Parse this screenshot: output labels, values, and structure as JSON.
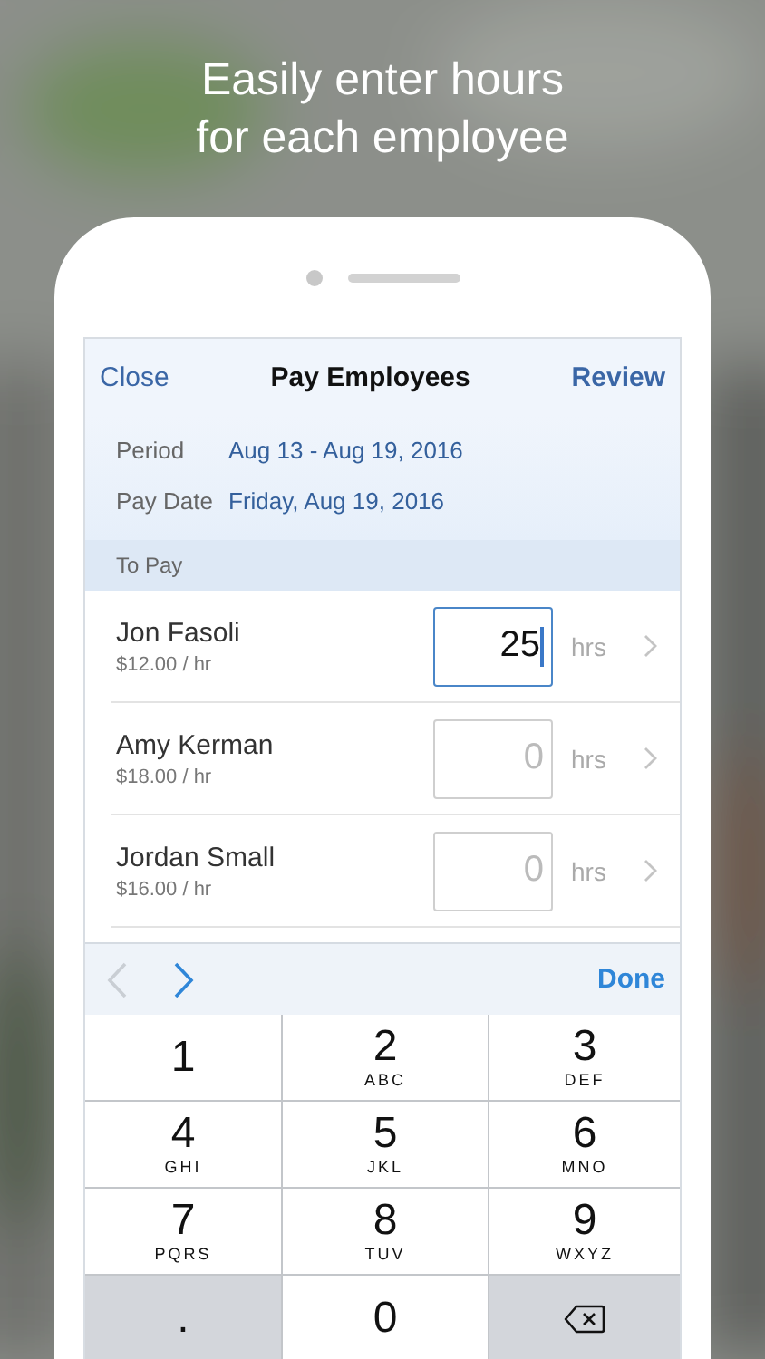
{
  "headline": "Easily enter hours\nfor each employee",
  "nav": {
    "left": "Close",
    "title": "Pay Employees",
    "right": "Review"
  },
  "info": [
    {
      "label": "Period",
      "value": "Aug 13 - Aug 19, 2016"
    },
    {
      "label": "Pay Date",
      "value": "Friday, Aug 19, 2016"
    }
  ],
  "section": "To Pay",
  "employees": [
    {
      "name": "Jon Fasoli",
      "rate": "$12.00 / hr",
      "value": "25",
      "selected": true,
      "unit": "hrs"
    },
    {
      "name": "Amy Kerman",
      "rate": "$18.00 / hr",
      "placeholder": "0",
      "selected": false,
      "unit": "hrs"
    },
    {
      "name": "Jordan Small",
      "rate": "$16.00 / hr",
      "placeholder": "0",
      "selected": false,
      "unit": "hrs"
    }
  ],
  "toolbar": {
    "prev_disabled": true,
    "next_disabled": false,
    "done": "Done"
  },
  "keys": [
    {
      "kind": "digit",
      "digit": "1"
    },
    {
      "kind": "digit",
      "digit": "2",
      "letters": "ABC"
    },
    {
      "kind": "digit",
      "digit": "3",
      "letters": "DEF"
    },
    {
      "kind": "digit",
      "digit": "4",
      "letters": "GHI"
    },
    {
      "kind": "digit",
      "digit": "5",
      "letters": "JKL"
    },
    {
      "kind": "digit",
      "digit": "6",
      "letters": "MNO"
    },
    {
      "kind": "digit",
      "digit": "7",
      "letters": "PQRS"
    },
    {
      "kind": "digit",
      "digit": "8",
      "letters": "TUV"
    },
    {
      "kind": "digit",
      "digit": "9",
      "letters": "WXYZ"
    },
    {
      "kind": "symbol",
      "digit": "."
    },
    {
      "kind": "digit",
      "digit": "0"
    },
    {
      "kind": "delete"
    }
  ]
}
